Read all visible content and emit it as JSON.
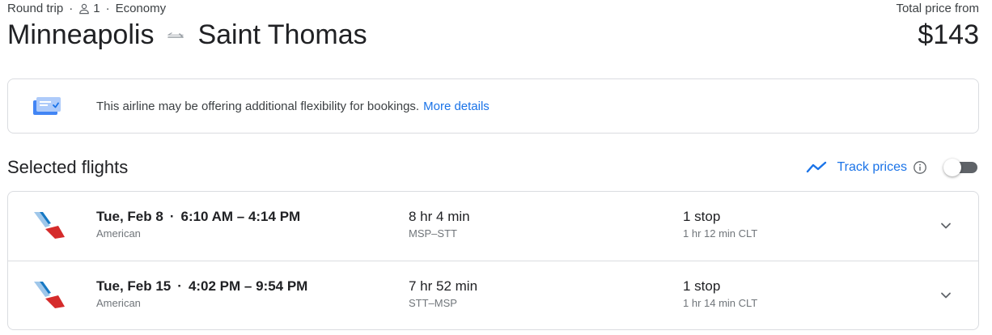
{
  "header": {
    "trip_type": "Round trip",
    "separator": "·",
    "passengers": "1",
    "cabin": "Economy",
    "origin": "Minneapolis",
    "destination": "Saint Thomas",
    "total_label": "Total price from",
    "total_price": "$143"
  },
  "banner": {
    "icon": "ticket-flex-icon",
    "text": "This airline may be offering additional flexibility for bookings.",
    "link": "More details"
  },
  "selected": {
    "title": "Selected flights",
    "track_label": "Track prices",
    "track_enabled": false
  },
  "flights": [
    {
      "date": "Tue, Feb 8",
      "separator": "·",
      "times": "6:10 AM – 4:14 PM",
      "airline": "American",
      "duration": "8 hr 4 min",
      "route": "MSP–STT",
      "stops": "1 stop",
      "layover": "1 hr 12 min CLT"
    },
    {
      "date": "Tue, Feb 15",
      "separator": "·",
      "times": "4:02 PM – 9:54 PM",
      "airline": "American",
      "duration": "7 hr 52 min",
      "route": "STT–MSP",
      "stops": "1 stop",
      "layover": "1 hr 14 min CLT"
    }
  ],
  "colors": {
    "link": "#1a73e8",
    "text": "#202124",
    "muted": "#70757a",
    "border": "#dadce0"
  }
}
